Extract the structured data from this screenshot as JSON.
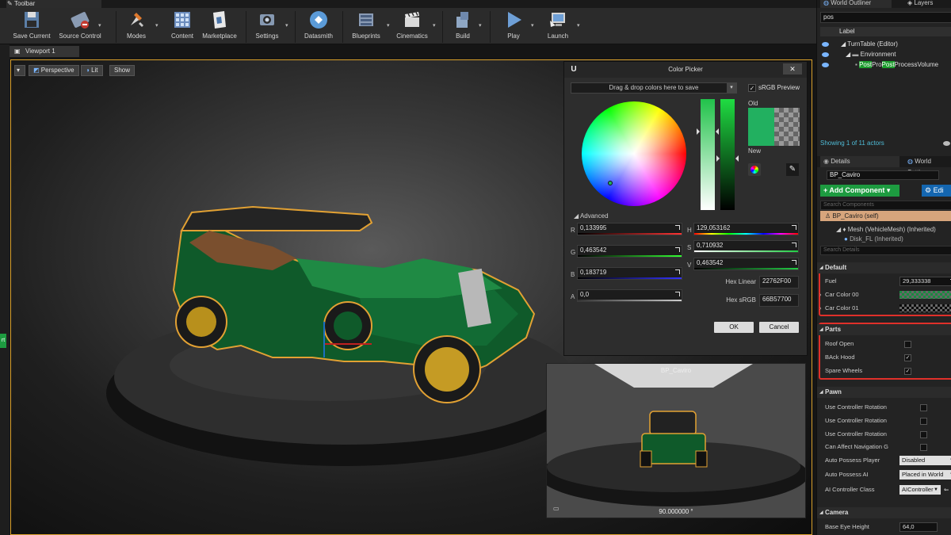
{
  "tabs": {
    "toolbar": "Toolbar",
    "viewport": "Viewport 1",
    "world_outliner": "World Outliner",
    "layers": "Layers",
    "details": "Details",
    "world_settings": "World Settings"
  },
  "toolbar": [
    {
      "label": "Save Current",
      "icon": "save-icon"
    },
    {
      "label": "Source Control",
      "icon": "source-control-icon"
    },
    {
      "label": "Modes",
      "icon": "modes-icon"
    },
    {
      "label": "Content",
      "icon": "content-icon"
    },
    {
      "label": "Marketplace",
      "icon": "marketplace-icon"
    },
    {
      "label": "Settings",
      "icon": "settings-icon"
    },
    {
      "label": "Datasmith",
      "icon": "datasmith-icon"
    },
    {
      "label": "Blueprints",
      "icon": "blueprints-icon"
    },
    {
      "label": "Cinematics",
      "icon": "cinematics-icon"
    },
    {
      "label": "Build",
      "icon": "build-icon"
    },
    {
      "label": "Play",
      "icon": "play-icon"
    },
    {
      "label": "Launch",
      "icon": "launch-icon"
    }
  ],
  "viewport": {
    "perspective": "Perspective",
    "lit": "Lit",
    "show": "Show"
  },
  "color_picker": {
    "title": "Color Picker",
    "dropzone": "Drag & drop colors here to save",
    "srgb_preview": "sRGB Preview",
    "old": "Old",
    "new": "New",
    "advanced": "Advanced",
    "r": {
      "label": "R",
      "value": "0,133995"
    },
    "g": {
      "label": "G",
      "value": "0,463542"
    },
    "b": {
      "label": "B",
      "value": "0,183719"
    },
    "a": {
      "label": "A",
      "value": "0,0"
    },
    "h": {
      "label": "H",
      "value": "129,053162"
    },
    "s": {
      "label": "S",
      "value": "0,710932"
    },
    "v": {
      "label": "V",
      "value": "0,463542"
    },
    "hex_linear_label": "Hex Linear",
    "hex_linear": "22762F00",
    "hex_srgb_label": "Hex sRGB",
    "hex_srgb": "66B57700",
    "ok": "OK",
    "cancel": "Cancel",
    "old_color": "#22b060"
  },
  "preview": {
    "title": "BP_Caviro",
    "angle": "90.000000 °"
  },
  "outliner": {
    "search": "pos",
    "column": "Label",
    "rows": [
      "TurnTable (Editor)",
      "Environment"
    ],
    "hit": {
      "p1": "Post",
      "p2": "Pro",
      "p3": "Post",
      "p4": "ProcessVolume"
    },
    "footer": "Showing 1 of 11 actors"
  },
  "details": {
    "name": "BP_Caviro",
    "add_component": "+ Add Component ▾",
    "edit_blueprint": "Edi",
    "search_components": "Search Components",
    "self": "BP_Caviro (self)",
    "mesh": "Mesh (VehicleMesh) (Inherited)",
    "disk": "Disk_FL (Inherited)",
    "search_details": "Search Details",
    "sections": {
      "default": "Default",
      "parts": "Parts",
      "pawn": "Pawn",
      "camera": "Camera"
    },
    "fuel_label": "Fuel",
    "fuel_value": "29,333338",
    "car_color_00": "Car Color 00",
    "car_color_01": "Car Color 01",
    "roof_open": "Roof Open",
    "back_hood": "BAck Hood",
    "spare_wheels": "Spare Wheels",
    "use_ctrl_rot_1": "Use Controller Rotation",
    "use_ctrl_rot_2": "Use Controller Rotation",
    "use_ctrl_rot_3": "Use Controller Rotation",
    "can_affect_nav": "Can Affect Navigation G",
    "auto_possess_player": "Auto Possess Player",
    "auto_possess_player_value": "Disabled",
    "auto_possess_ai": "Auto Possess AI",
    "auto_possess_ai_value": "Placed in World",
    "ai_controller_class": "AI Controller Class",
    "ai_controller_class_value": "AIController",
    "base_eye_height": "Base Eye Height",
    "base_eye_height_value": "64,0"
  },
  "left_green_label": "rt"
}
